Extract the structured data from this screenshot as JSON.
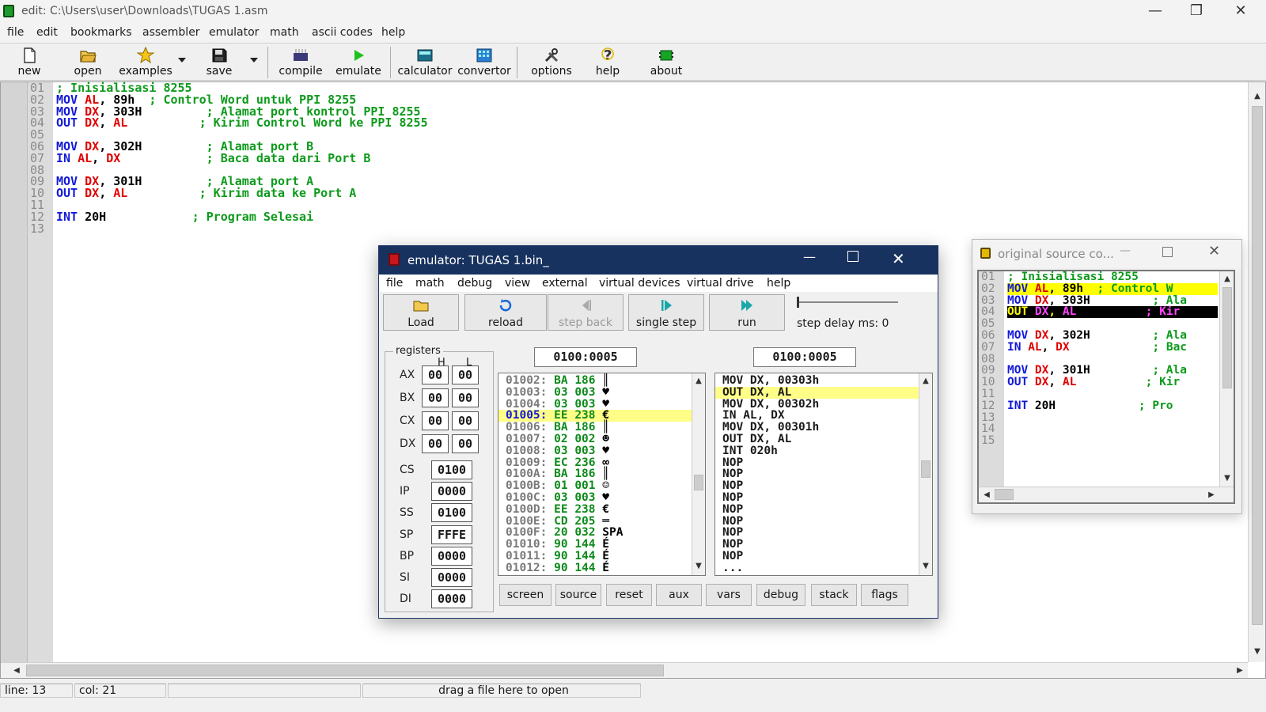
{
  "window": {
    "title": "edit: C:\\Users\\user\\Downloads\\TUGAS 1.asm"
  },
  "menu": [
    "file",
    "edit",
    "bookmarks",
    "assembler",
    "emulator",
    "math",
    "ascii codes",
    "help"
  ],
  "toolbar": {
    "new": "new",
    "open": "open",
    "examples": "examples",
    "save": "save",
    "compile": "compile",
    "emulate": "emulate",
    "calculator": "calculator",
    "convertor": "convertor",
    "options": "options",
    "help": "help",
    "about": "about"
  },
  "editor": {
    "line_numbers": [
      "01",
      "02",
      "03",
      "04",
      "05",
      "06",
      "07",
      "08",
      "09",
      "10",
      "11",
      "12",
      "13"
    ],
    "lines": [
      [
        {
          "t": "; Inisialisasi 8255",
          "c": "cm"
        }
      ],
      [
        {
          "t": "MOV ",
          "c": "kw"
        },
        {
          "t": "AL",
          "c": "rg"
        },
        {
          "t": ", 89h  ",
          "c": "nm"
        },
        {
          "t": "; Control Word untuk PPI 8255",
          "c": "cm"
        }
      ],
      [
        {
          "t": "MOV ",
          "c": "kw"
        },
        {
          "t": "DX",
          "c": "rg"
        },
        {
          "t": ", 303H         ",
          "c": "nm"
        },
        {
          "t": "; Alamat port kontrol PPI 8255",
          "c": "cm"
        }
      ],
      [
        {
          "t": "OUT ",
          "c": "kw"
        },
        {
          "t": "DX",
          "c": "rg"
        },
        {
          "t": ", ",
          "c": "nm"
        },
        {
          "t": "AL",
          "c": "rg"
        },
        {
          "t": "          ",
          "c": "nm"
        },
        {
          "t": "; Kirim Control Word ke PPI 8255",
          "c": "cm"
        }
      ],
      [],
      [
        {
          "t": "MOV ",
          "c": "kw"
        },
        {
          "t": "DX",
          "c": "rg"
        },
        {
          "t": ", 302H         ",
          "c": "nm"
        },
        {
          "t": "; Alamat port B",
          "c": "cm"
        }
      ],
      [
        {
          "t": "IN ",
          "c": "kw"
        },
        {
          "t": "AL",
          "c": "rg"
        },
        {
          "t": ", ",
          "c": "nm"
        },
        {
          "t": "DX",
          "c": "rg"
        },
        {
          "t": "            ",
          "c": "nm"
        },
        {
          "t": "; Baca data dari Port B",
          "c": "cm"
        }
      ],
      [],
      [
        {
          "t": "MOV ",
          "c": "kw"
        },
        {
          "t": "DX",
          "c": "rg"
        },
        {
          "t": ", 301H         ",
          "c": "nm"
        },
        {
          "t": "; Alamat port A",
          "c": "cm"
        }
      ],
      [
        {
          "t": "OUT ",
          "c": "kw"
        },
        {
          "t": "DX",
          "c": "rg"
        },
        {
          "t": ", ",
          "c": "nm"
        },
        {
          "t": "AL",
          "c": "rg"
        },
        {
          "t": "          ",
          "c": "nm"
        },
        {
          "t": "; Kirim data ke Port A",
          "c": "cm"
        }
      ],
      [],
      [
        {
          "t": "INT ",
          "c": "kw"
        },
        {
          "t": "20H            ",
          "c": "nm"
        },
        {
          "t": "; Program Selesai",
          "c": "cm"
        }
      ],
      []
    ]
  },
  "status": {
    "line": "line: 13",
    "col": "col: 21",
    "hint": "drag a file here to open"
  },
  "emulator": {
    "title": "emulator: TUGAS 1.bin_",
    "menu": [
      "file",
      "math",
      "debug",
      "view",
      "external",
      "virtual devices",
      "virtual drive",
      "help"
    ],
    "buttons": {
      "load": "Load",
      "reload": "reload",
      "step_back": "step back",
      "single_step": "single step",
      "run": "run"
    },
    "step_delay": "step delay ms: 0",
    "registers_label": "registers",
    "h_label": "H",
    "l_label": "L",
    "regs8": [
      {
        "name": "AX",
        "h": "00",
        "l": "00"
      },
      {
        "name": "BX",
        "h": "00",
        "l": "00"
      },
      {
        "name": "CX",
        "h": "00",
        "l": "00"
      },
      {
        "name": "DX",
        "h": "00",
        "l": "00"
      }
    ],
    "regs16": [
      {
        "name": "CS",
        "v": "0100"
      },
      {
        "name": "IP",
        "v": "0000"
      },
      {
        "name": "SS",
        "v": "0100"
      },
      {
        "name": "SP",
        "v": "FFFE"
      },
      {
        "name": "BP",
        "v": "0000"
      },
      {
        "name": "SI",
        "v": "0000"
      },
      {
        "name": "DI",
        "v": "0000"
      }
    ],
    "addr_left": "0100:0005",
    "addr_right": "0100:0005",
    "memory": [
      {
        "a": "01002:",
        "h": "BA",
        "d": "186",
        "ch": "║"
      },
      {
        "a": "01003:",
        "h": "03",
        "d": "003",
        "ch": "♥"
      },
      {
        "a": "01004:",
        "h": "03",
        "d": "003",
        "ch": "♥"
      },
      {
        "a": "01005:",
        "h": "EE",
        "d": "238",
        "ch": "€",
        "hl": true
      },
      {
        "a": "01006:",
        "h": "BA",
        "d": "186",
        "ch": "║"
      },
      {
        "a": "01007:",
        "h": "02",
        "d": "002",
        "ch": "☻"
      },
      {
        "a": "01008:",
        "h": "03",
        "d": "003",
        "ch": "♥"
      },
      {
        "a": "01009:",
        "h": "EC",
        "d": "236",
        "ch": "∞"
      },
      {
        "a": "0100A:",
        "h": "BA",
        "d": "186",
        "ch": "║"
      },
      {
        "a": "0100B:",
        "h": "01",
        "d": "001",
        "ch": "☺"
      },
      {
        "a": "0100C:",
        "h": "03",
        "d": "003",
        "ch": "♥"
      },
      {
        "a": "0100D:",
        "h": "EE",
        "d": "238",
        "ch": "€"
      },
      {
        "a": "0100E:",
        "h": "CD",
        "d": "205",
        "ch": "═"
      },
      {
        "a": "0100F:",
        "h": "20",
        "d": "032",
        "ch": "SPA"
      },
      {
        "a": "01010:",
        "h": "90",
        "d": "144",
        "ch": "É"
      },
      {
        "a": "01011:",
        "h": "90",
        "d": "144",
        "ch": "É"
      },
      {
        "a": "01012:",
        "h": "90",
        "d": "144",
        "ch": "É"
      }
    ],
    "disasm": [
      {
        "t": "MOV DX, 00303h"
      },
      {
        "t": "OUT DX, AL",
        "hl": true
      },
      {
        "t": "MOV DX, 00302h"
      },
      {
        "t": "IN AL, DX"
      },
      {
        "t": "MOV DX, 00301h"
      },
      {
        "t": "OUT DX, AL"
      },
      {
        "t": "INT 020h"
      },
      {
        "t": "NOP"
      },
      {
        "t": "NOP"
      },
      {
        "t": "NOP"
      },
      {
        "t": "NOP"
      },
      {
        "t": "NOP"
      },
      {
        "t": "NOP"
      },
      {
        "t": "NOP"
      },
      {
        "t": "NOP"
      },
      {
        "t": "NOP"
      },
      {
        "t": "..."
      }
    ],
    "bottom_buttons": [
      "screen",
      "source",
      "reset",
      "aux",
      "vars",
      "debug",
      "stack",
      "flags"
    ]
  },
  "original_source": {
    "title": "original source co...",
    "line_numbers": [
      "01",
      "02",
      "03",
      "04",
      "05",
      "06",
      "07",
      "08",
      "09",
      "10",
      "11",
      "12",
      "13",
      "14",
      "15"
    ],
    "lines": [
      {
        "hl": "",
        "segs": [
          {
            "t": "; Inisialisasi 8255",
            "c": "cm"
          }
        ]
      },
      {
        "hl": "yy",
        "segs": [
          {
            "t": "MOV ",
            "c": "kw"
          },
          {
            "t": "AL",
            "c": "rg"
          },
          {
            "t": ", 89h  ",
            "c": "nm"
          },
          {
            "t": "; Control W",
            "c": "cm"
          }
        ]
      },
      {
        "hl": "",
        "segs": [
          {
            "t": "MOV ",
            "c": "kw"
          },
          {
            "t": "DX",
            "c": "rg"
          },
          {
            "t": ", 303H         ",
            "c": "nm"
          },
          {
            "t": "; Ala",
            "c": "cm"
          }
        ]
      },
      {
        "hl": "blk",
        "segs": [
          {
            "t": "OUT ",
            "c": "yw"
          },
          {
            "t": "DX",
            "c": "mg"
          },
          {
            "t": ", ",
            "c": "yw"
          },
          {
            "t": "AL",
            "c": "mg"
          },
          {
            "t": "          ",
            "c": "yw"
          },
          {
            "t": "; Kir",
            "c": "mg"
          }
        ]
      },
      {
        "hl": "",
        "segs": []
      },
      {
        "hl": "",
        "segs": [
          {
            "t": "MOV ",
            "c": "kw"
          },
          {
            "t": "DX",
            "c": "rg"
          },
          {
            "t": ", 302H         ",
            "c": "nm"
          },
          {
            "t": "; Ala",
            "c": "cm"
          }
        ]
      },
      {
        "hl": "",
        "segs": [
          {
            "t": "IN ",
            "c": "kw"
          },
          {
            "t": "AL",
            "c": "rg"
          },
          {
            "t": ", ",
            "c": "nm"
          },
          {
            "t": "DX",
            "c": "rg"
          },
          {
            "t": "            ",
            "c": "nm"
          },
          {
            "t": "; Bac",
            "c": "cm"
          }
        ]
      },
      {
        "hl": "",
        "segs": []
      },
      {
        "hl": "",
        "segs": [
          {
            "t": "MOV ",
            "c": "kw"
          },
          {
            "t": "DX",
            "c": "rg"
          },
          {
            "t": ", 301H         ",
            "c": "nm"
          },
          {
            "t": "; Ala",
            "c": "cm"
          }
        ]
      },
      {
        "hl": "",
        "segs": [
          {
            "t": "OUT ",
            "c": "kw"
          },
          {
            "t": "DX",
            "c": "rg"
          },
          {
            "t": ", ",
            "c": "nm"
          },
          {
            "t": "AL",
            "c": "rg"
          },
          {
            "t": "          ",
            "c": "nm"
          },
          {
            "t": "; Kir",
            "c": "cm"
          }
        ]
      },
      {
        "hl": "",
        "segs": []
      },
      {
        "hl": "",
        "segs": [
          {
            "t": "INT ",
            "c": "kw"
          },
          {
            "t": "20H            ",
            "c": "nm"
          },
          {
            "t": "; Pro",
            "c": "cm"
          }
        ]
      },
      {
        "hl": "",
        "segs": []
      },
      {
        "hl": "",
        "segs": []
      },
      {
        "hl": "",
        "segs": []
      }
    ]
  },
  "colors": {
    "comment": "#0d9a1b",
    "keyword": "#1218d8",
    "register": "#e00000",
    "emulator_titlebar": "#18325f",
    "highlight": "#ffff88"
  },
  "icons": [
    "app-chip-icon",
    "new-file-icon",
    "open-folder-icon",
    "examples-star-icon",
    "save-disk-icon",
    "compile-icon",
    "emulate-play-icon",
    "calculator-icon",
    "convertor-icon",
    "options-tools-icon",
    "help-question-icon",
    "about-chip-icon"
  ]
}
